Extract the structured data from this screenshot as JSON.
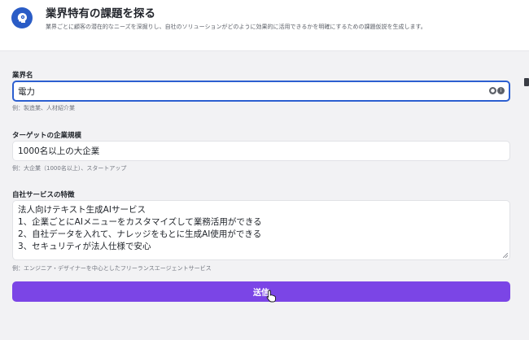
{
  "header": {
    "title": "業界特有の課題を探る",
    "description": "業界ごとに顧客の潜在的なニーズを深掘りし、自社のソリューションがどのように効果的に活用できるかを明確にするための課題仮説を生成します。",
    "icon": "brain-gear-icon"
  },
  "form": {
    "industry": {
      "label": "業界名",
      "value": "電力",
      "hint": "例：製造業、人材紹介業"
    },
    "company_size": {
      "label": "ターゲットの企業規模",
      "value": "1000名以上の大企業",
      "hint": "例：大企業（1000名以上）、スタートアップ"
    },
    "service_features": {
      "label": "自社サービスの特徴",
      "lines": [
        "法人向けテキスト生成AIサービス",
        "1、企業ごとにAIメニューをカスタマイズして業務活用ができる",
        "2、自社データを入れて、ナレッジをもとに生成AI使用ができる",
        "3、セキュリティが法人仕様で安心"
      ],
      "hint": "例：エンジニア・デザイナーを中心としたフリーランスエージェントサービス"
    },
    "submit_label": "送信"
  },
  "colors": {
    "accent": "#7b45e6",
    "focus_border": "#2c5fd0",
    "icon_bg": "#2a5cc6"
  }
}
